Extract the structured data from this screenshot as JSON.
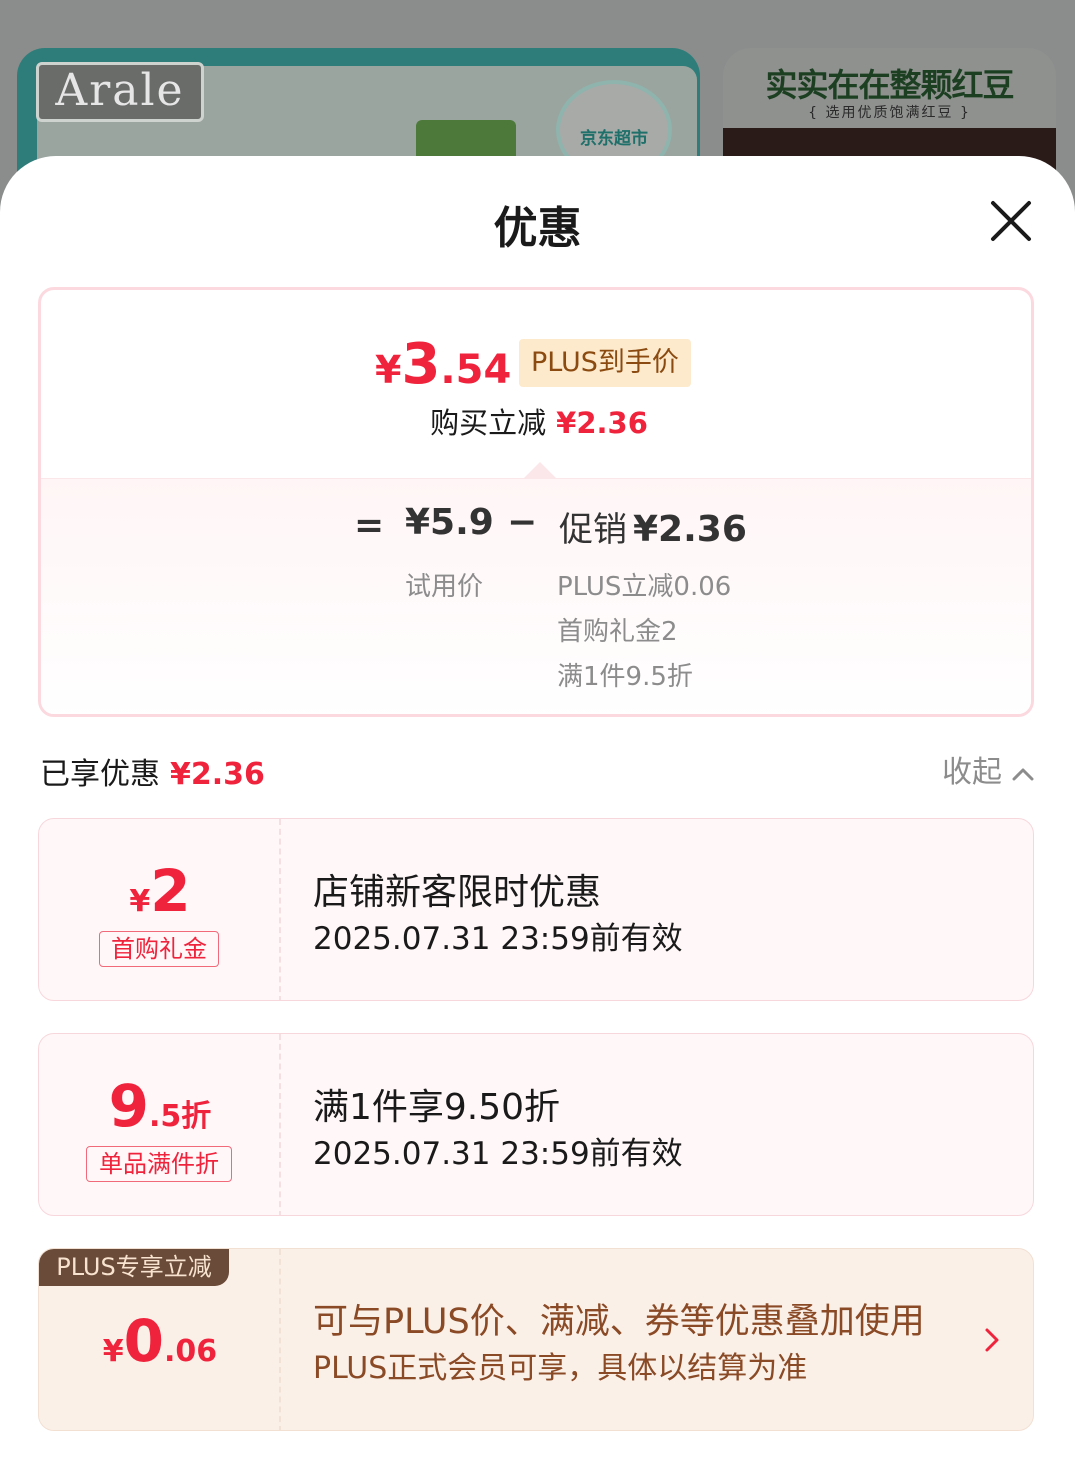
{
  "background": {
    "brand_logo": "Arale",
    "badge_text": "京东超市",
    "right_banner_title": "实实在在整颗红豆",
    "right_banner_subtitle": "{ 选用优质饱满红豆 }"
  },
  "sheet": {
    "title": "优惠",
    "close_icon": "close-icon"
  },
  "summary": {
    "final_price": {
      "currency": "¥",
      "integer": "3",
      "decimal": ".54"
    },
    "plus_tag": "PLUS到手价",
    "reduce_label": "购买立减",
    "reduce_amount": "¥2.36",
    "equation": {
      "equals": "=",
      "base_price": "¥5.9",
      "minus": "−",
      "promo_label": "促销",
      "promo_amount": "¥2.36",
      "base_caption": "试用价",
      "promo_details": [
        "PLUS立减0.06",
        "首购礼金2",
        "满1件9.5折"
      ]
    }
  },
  "enjoyed": {
    "label": "已享优惠",
    "amount": "¥2.36",
    "collapse_label": "收起",
    "collapse_icon": "chevron-up-icon"
  },
  "coupons": [
    {
      "value_currency": "¥",
      "value_main": "2",
      "value_suffix": "",
      "tag": "首购礼金",
      "title": "店铺新客限时优惠",
      "validity": "2025.07.31 23:59前有效"
    },
    {
      "value_currency": "",
      "value_main": "9",
      "value_suffix": ".5折",
      "tag": "单品满件折",
      "title": "满1件享9.50折",
      "validity": "2025.07.31 23:59前有效"
    }
  ],
  "plus_coupon": {
    "badge": "PLUS专享立减",
    "value_currency": "¥",
    "value_main": "0",
    "value_suffix": ".06",
    "title": "可与PLUS价、满减、券等优惠叠加使用",
    "subtitle": "PLUS正式会员可享，具体以结算为准",
    "arrow_icon": "chevron-right-icon"
  },
  "colors": {
    "accent_red": "#f0233c",
    "plus_brown": "#8a4a26",
    "plus_tag_bg": "#fdeacc"
  }
}
